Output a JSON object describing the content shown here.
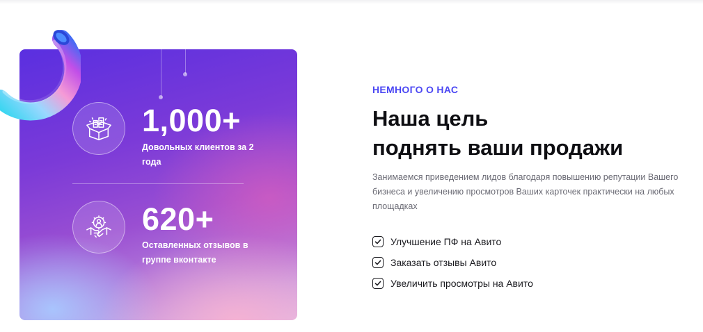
{
  "stats": [
    {
      "number": "1,000+",
      "caption": "Довольных клиентов за 2 года",
      "icon": "box-buildings-icon"
    },
    {
      "number": "620+",
      "caption": "Оставленных отзывов в группе вконтакте",
      "icon": "handshake-gear-icon"
    }
  ],
  "about": {
    "eyebrow": "НЕМНОГО О НАС",
    "heading_line1": "Наша цель",
    "heading_line2": "поднять ваши продажи",
    "description": "Занимаемся приведением лидов благодаря повышению репутации Вашего бизнеса и увеличению просмотров Ваших карточек практически на любых площадках",
    "checklist": [
      "Улучшение ПФ на Авито",
      "Заказать отзывы Авито",
      "Увеличить просмотры на Авито"
    ]
  },
  "colors": {
    "accent": "#4b47f3",
    "heading": "#0e0e12",
    "card_gradient_start": "#5a2fe0",
    "card_gradient_end": "#dcb8e8"
  }
}
